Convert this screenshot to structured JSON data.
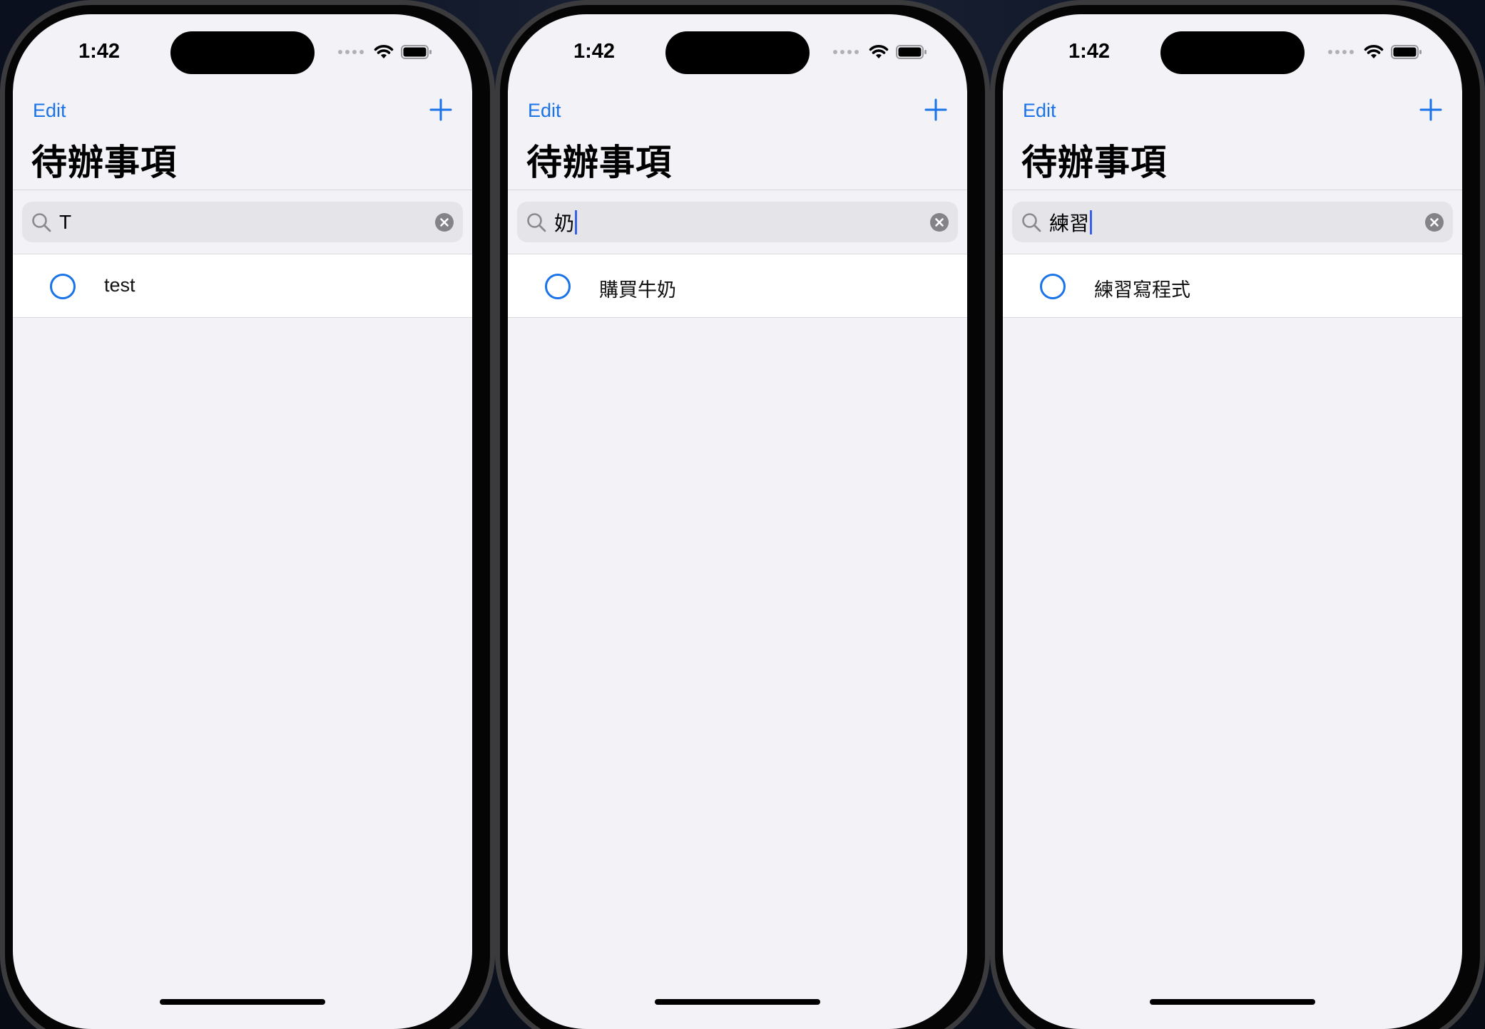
{
  "screens": [
    {
      "status": {
        "time": "1:42"
      },
      "nav": {
        "edit_label": "Edit",
        "add_icon": "plus-icon"
      },
      "title": "待辦事項",
      "search": {
        "query": "T",
        "caret_visible": false
      },
      "items": [
        {
          "title": "test",
          "completed": false
        }
      ]
    },
    {
      "status": {
        "time": "1:42"
      },
      "nav": {
        "edit_label": "Edit",
        "add_icon": "plus-icon"
      },
      "title": "待辦事項",
      "search": {
        "query": "奶",
        "caret_visible": true
      },
      "items": [
        {
          "title": "購買牛奶",
          "completed": false
        }
      ]
    },
    {
      "status": {
        "time": "1:42"
      },
      "nav": {
        "edit_label": "Edit",
        "add_icon": "plus-icon"
      },
      "title": "待辦事項",
      "search": {
        "query": "練習",
        "caret_visible": true
      },
      "items": [
        {
          "title": "練習寫程式",
          "completed": false
        }
      ]
    }
  ],
  "colors": {
    "accent": "#1a73e8",
    "background": "#f2f2f7",
    "search_field": "#e4e4e9",
    "caret": "#3a62e8"
  }
}
